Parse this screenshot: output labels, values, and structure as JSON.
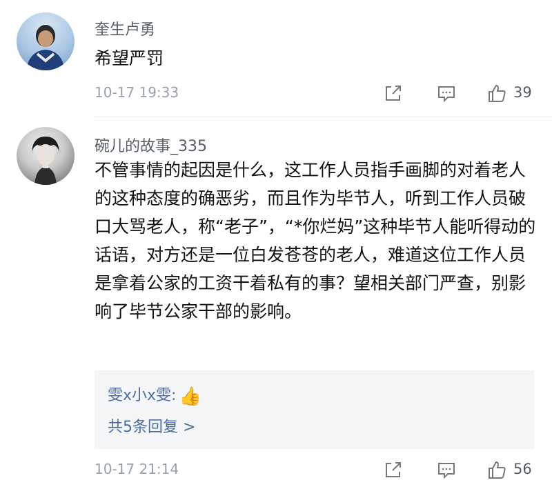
{
  "comments": [
    {
      "username": "奎生卢勇",
      "text": "希望严罚",
      "timestamp": "10-17 19:33",
      "likes": "39",
      "avatar_icon": "avatar-man-icon"
    },
    {
      "username": "碗儿的故事_335",
      "text": "不管事情的起因是什么，这工作人员指手画脚的对着老人的这种态度的确恶劣，而且作为毕节人，听到工作人员破口大骂老人，称“老子”，“*你烂妈”这种毕节人能听得动的话语，对方还是一位白发苍苍的老人，难道这位工作人员是拿着公家的工资干着私有的事？望相关部门严查，别影响了毕节公家干部的影响。",
      "timestamp": "10-17 21:14",
      "likes": "56",
      "avatar_icon": "avatar-woman-icon",
      "reply": {
        "author": "雯x小x雯:",
        "emoji": "👍",
        "more": "共5条回复 >"
      }
    }
  ],
  "icons": {
    "share": "share-icon",
    "comment": "comment-icon",
    "like": "thumbs-up-icon"
  },
  "colors": {
    "username": "#555c66",
    "reply_link": "#4a6f9f",
    "timestamp": "#9aa0a8",
    "reply_bg": "#f4f5f7"
  }
}
